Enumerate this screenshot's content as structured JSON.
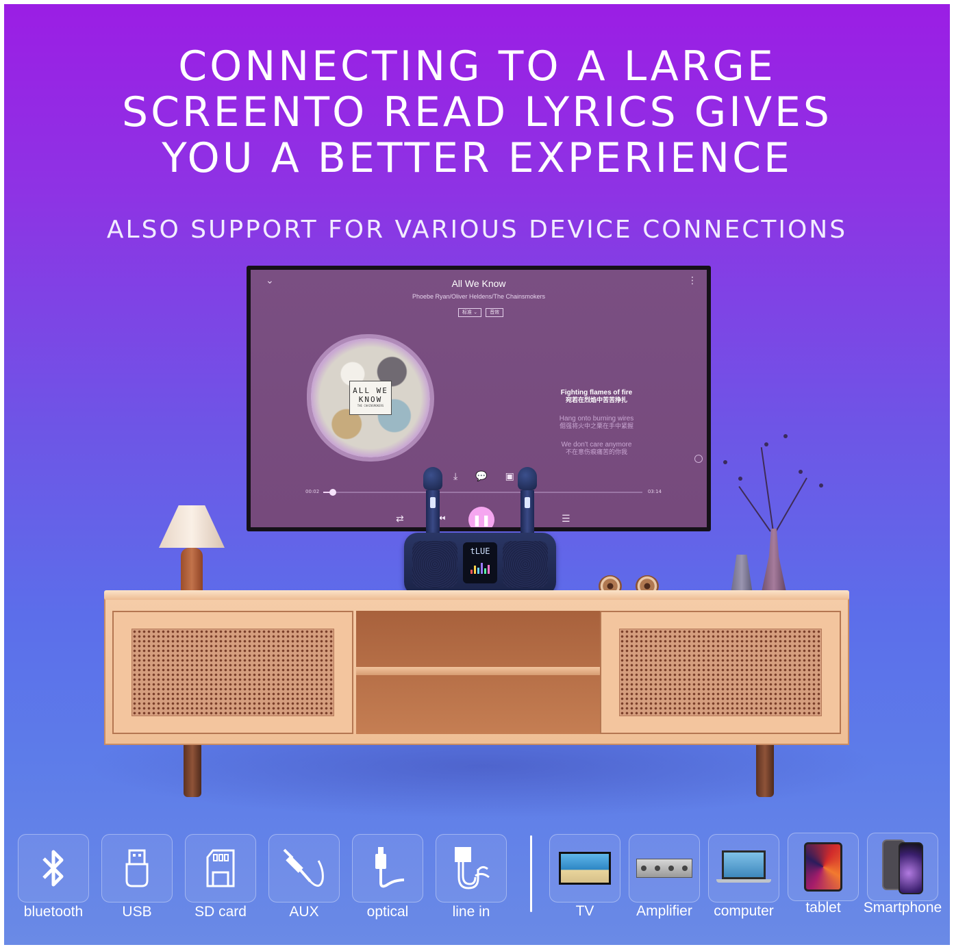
{
  "headline": {
    "line1": "CONNECTING  TO A LARGE",
    "line2": "SCREENTO READ LYRICS GIVES",
    "line3": "YOU A BETTER EXPERIENCE"
  },
  "subheadline": "ALSO SUPPORT FOR VARIOUS DEVICE CONNECTIONS",
  "player": {
    "song_title": "All We Know",
    "artist": "Phoebe Ryan/Oliver Heldens/The Chainsmokers",
    "chip_quality": "标准 ⌄",
    "chip_effect": "音效",
    "album_text": "ALL WE KNOW",
    "album_subtext": "THE CHAINSMOKERS",
    "lyrics": [
      {
        "en": "Fighting flames of fire",
        "zh": "宛若在烈焰中苦苦挣扎"
      },
      {
        "en": "Hang onto burning wires",
        "zh": "倔强将火中之栗在手中紧握"
      },
      {
        "en": "We don't care anymore",
        "zh": "不在意伤痕痛苦的你我"
      }
    ],
    "time_elapsed": "00:02",
    "time_total": "03:14",
    "progress_fraction": 0.03,
    "speaker_display": "tLUE"
  },
  "connections": [
    {
      "label": "bluetooth",
      "icon": "bluetooth-icon"
    },
    {
      "label": "USB",
      "icon": "usb-icon"
    },
    {
      "label": "SD card",
      "icon": "sd-card-icon"
    },
    {
      "label": "AUX",
      "icon": "aux-cable-icon"
    },
    {
      "label": "optical",
      "icon": "optical-cable-icon"
    },
    {
      "label": "line in",
      "icon": "line-in-icon"
    }
  ],
  "devices": [
    {
      "label": "TV",
      "icon": "tv-icon"
    },
    {
      "label": "Amplifier",
      "icon": "amplifier-icon"
    },
    {
      "label": "computer",
      "icon": "laptop-icon"
    },
    {
      "label": "tablet",
      "icon": "tablet-icon"
    },
    {
      "label": "Smartphone",
      "icon": "smartphone-icon"
    }
  ],
  "colors": {
    "background_top": "#9b1ee4",
    "background_bottom": "#6a8ae6",
    "screen": "#7a4f82",
    "play_button": "#f5a6f0",
    "cabinet_wood": "#f5cca8"
  }
}
